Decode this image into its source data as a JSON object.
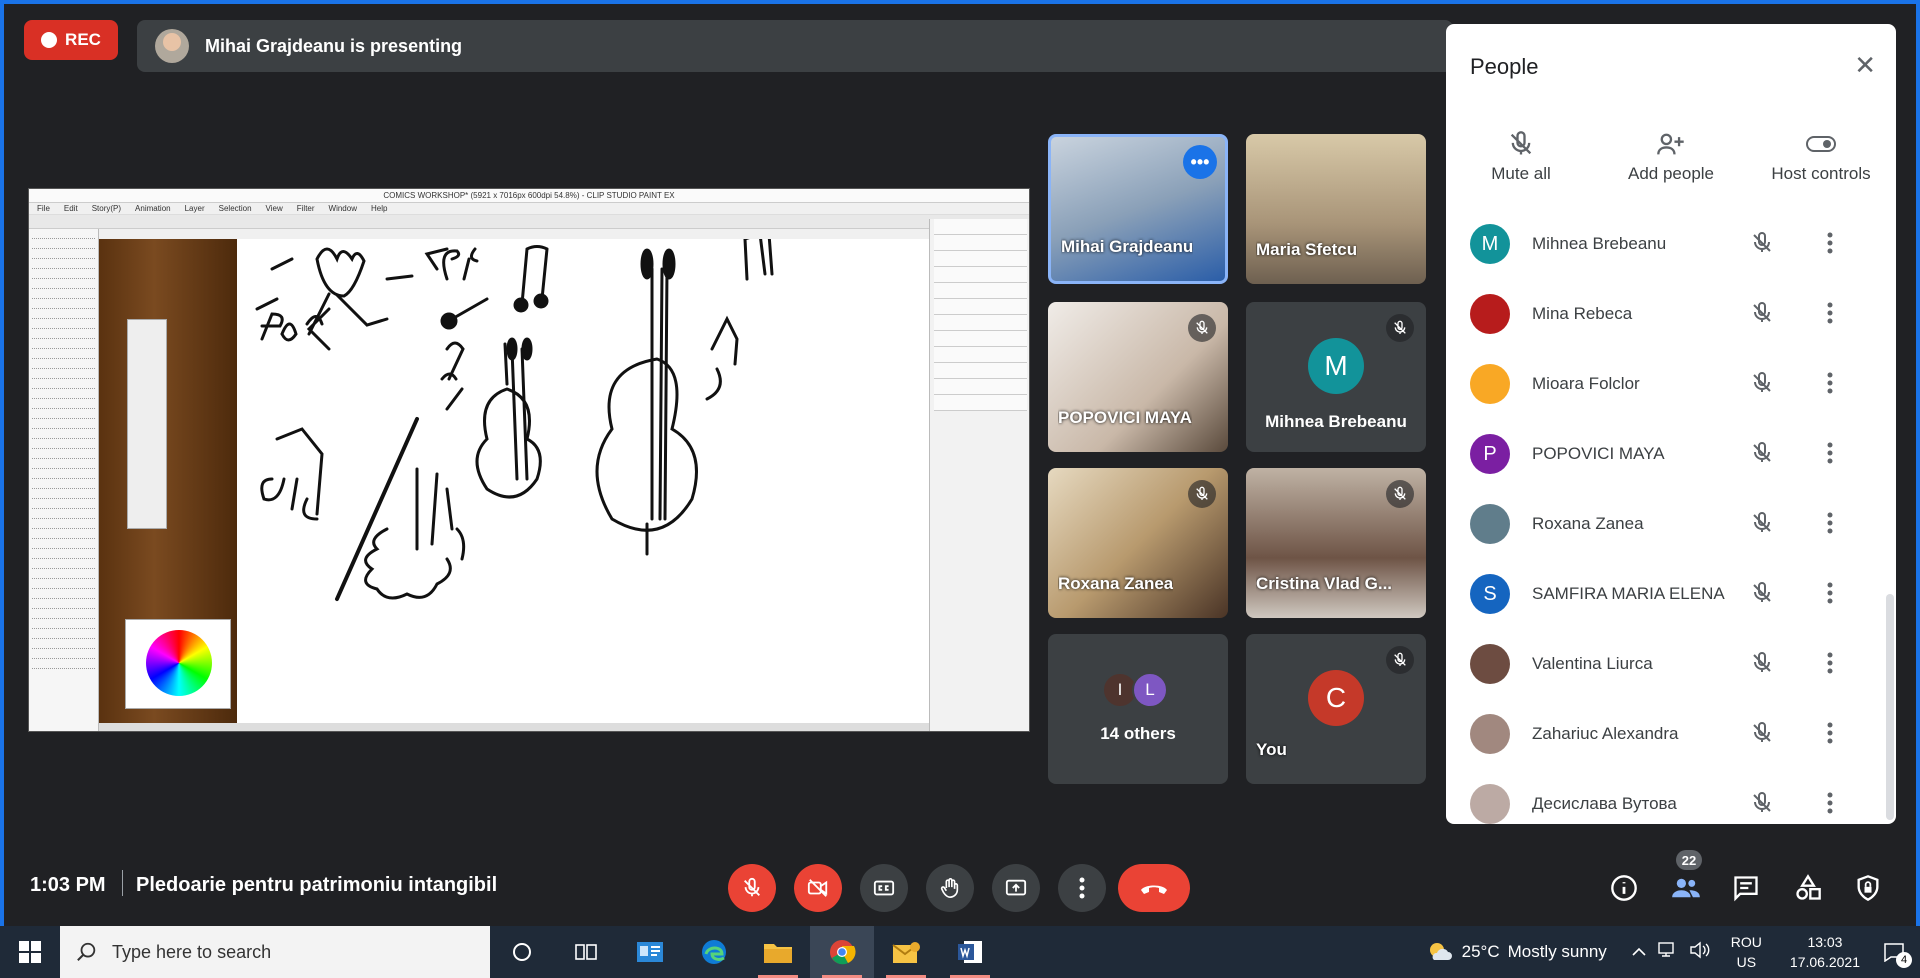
{
  "top": {
    "rec_label": "REC",
    "presenting_text": "Mihai Grajdeanu is presenting"
  },
  "shared_screen": {
    "window_title": "COMICS WORKSHOP* (5921 x 7016px 600dpi 54.8%) - CLIP STUDIO PAINT EX",
    "menu": [
      "File",
      "Edit",
      "Story(P)",
      "Animation",
      "Layer",
      "Selection",
      "View",
      "Filter",
      "Window",
      "Help"
    ]
  },
  "tiles": [
    {
      "name": "Mihai Grajdeanu",
      "type": "video",
      "active": true,
      "muted": false
    },
    {
      "name": "Maria Sfetcu",
      "type": "video",
      "active": false,
      "muted": false
    },
    {
      "name": "POPOVICI MAYA",
      "type": "video",
      "muted": true
    },
    {
      "name": "Mihnea Brebeanu",
      "type": "avatar",
      "initial": "M",
      "color": "#12939a",
      "muted": true
    },
    {
      "name": "Roxana Zanea",
      "type": "video",
      "muted": true
    },
    {
      "name": "Cristina Vlad G...",
      "type": "video",
      "muted": true
    },
    {
      "label": "14 others",
      "avatars": [
        {
          "initial": "I",
          "color": "#4e342e"
        },
        {
          "initial": "L",
          "color": "#7e57c2"
        }
      ]
    },
    {
      "name": "You",
      "type": "avatar",
      "initial": "C",
      "color": "#c53929",
      "muted": true
    }
  ],
  "people_panel": {
    "title": "People",
    "actions": [
      {
        "label": "Mute all",
        "icon": "mic-off-icon"
      },
      {
        "label": "Add people",
        "icon": "person-add-icon"
      },
      {
        "label": "Host controls",
        "icon": "toggle-icon"
      }
    ],
    "people": [
      {
        "name": "Mihnea Brebeanu",
        "initial": "M",
        "color": "#12939a"
      },
      {
        "name": "Mina Rebeca",
        "initial": "",
        "color": "#b71c1c"
      },
      {
        "name": "Mioara Folclor",
        "initial": "",
        "color": "#f9a825"
      },
      {
        "name": "POPOVICI MAYA",
        "initial": "P",
        "color": "#7b1fa2"
      },
      {
        "name": "Roxana Zanea",
        "initial": "",
        "color": "#607d8b"
      },
      {
        "name": "SAMFIRA MARIA ELENA",
        "initial": "S",
        "color": "#1565c0"
      },
      {
        "name": "Valentina Liurca",
        "initial": "",
        "color": "#6d4c41"
      },
      {
        "name": "Zahariuc Alexandra",
        "initial": "",
        "color": "#a1887f"
      },
      {
        "name": "Десислава Вутова",
        "initial": "",
        "color": "#bcaaa4"
      }
    ]
  },
  "bottom": {
    "time": "1:03 PM",
    "meeting_title": "Pledoarie pentru patrimoniu intangibil",
    "people_count": "22"
  },
  "taskbar": {
    "search_placeholder": "Type here to search",
    "weather_temp": "25°C",
    "weather_desc": "Mostly sunny",
    "lang_line1": "ROU",
    "lang_line2": "US",
    "clock_time": "13:03",
    "clock_date": "17.06.2021",
    "notif_count": "4"
  },
  "colors": {
    "accent": "#1a73e8",
    "danger": "#ea4335",
    "surface": "#3c4043",
    "background": "#202124"
  }
}
